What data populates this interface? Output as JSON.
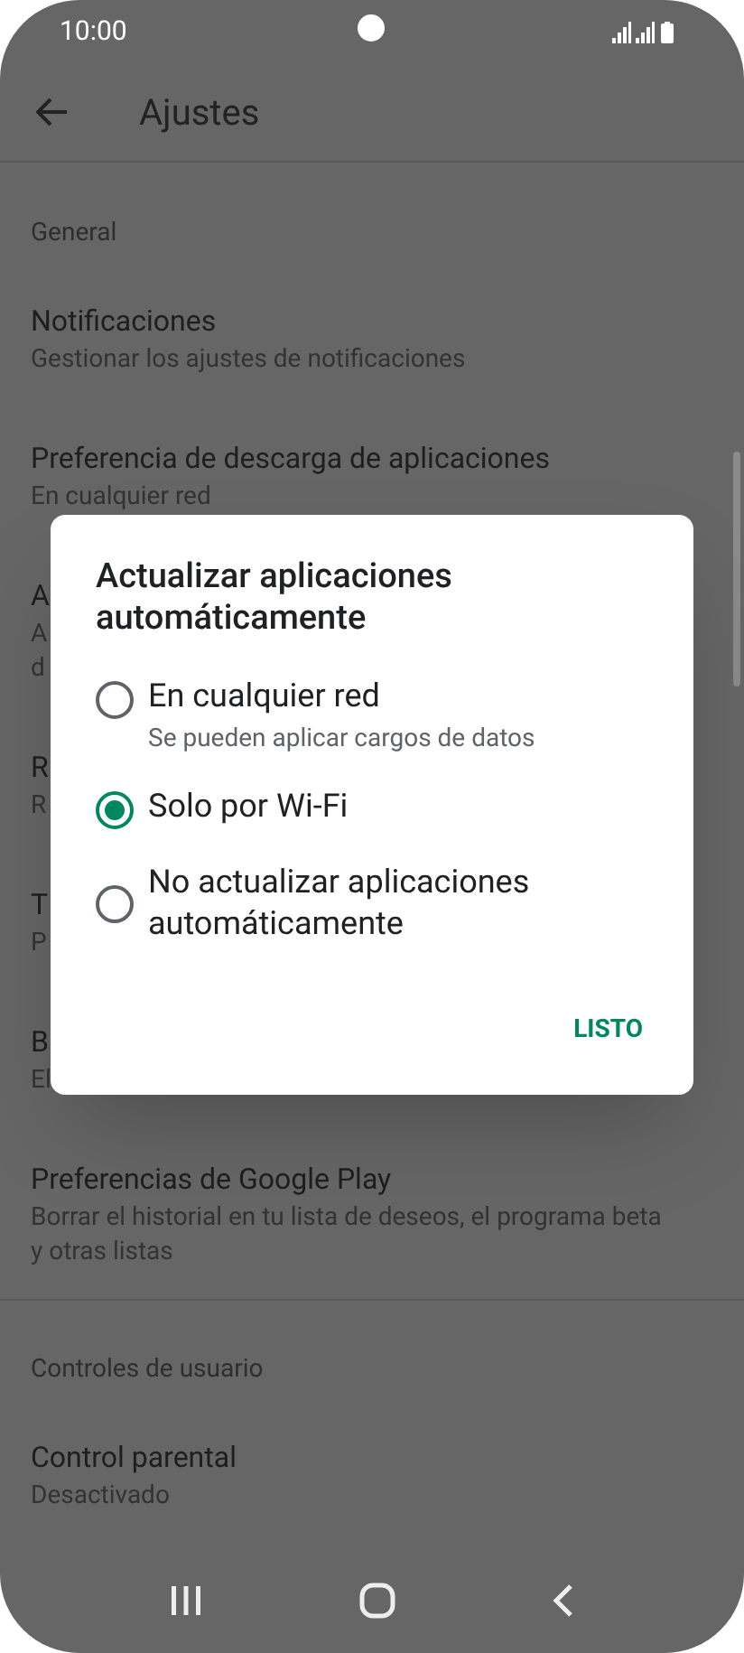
{
  "status_bar": {
    "time": "10:00"
  },
  "header": {
    "title": "Ajustes"
  },
  "sections": [
    {
      "heading": "General",
      "items": [
        {
          "title": "Notificaciones",
          "subtitle": [
            "Gestionar los ajustes de notificaciones"
          ]
        },
        {
          "title": "Preferencia de descarga de aplicaciones",
          "subtitle": [
            "En cualquier red"
          ]
        },
        {
          "title": "A",
          "subtitle": [
            "A",
            "d"
          ]
        },
        {
          "title": "R",
          "subtitle": [
            "R"
          ]
        },
        {
          "title": "T",
          "subtitle": [
            "P"
          ]
        },
        {
          "title": "B",
          "subtitle": [
            "El"
          ]
        },
        {
          "title": "Preferencias de Google Play",
          "subtitle": [
            "Borrar el historial en tu lista de deseos, el programa beta",
            "y otras listas"
          ]
        }
      ]
    },
    {
      "heading": "Controles de usuario",
      "items": [
        {
          "title": "Control parental",
          "subtitle": [
            "Desactivado"
          ]
        }
      ]
    }
  ],
  "dialog": {
    "title": "Actualizar aplicaciones automáticamente",
    "options": [
      {
        "label": "En cualquier red",
        "sublabel": "Se pueden aplicar cargos de datos",
        "selected": false
      },
      {
        "label": "Solo por Wi-Fi",
        "selected": true
      },
      {
        "label": "No actualizar aplicaciones automáticamente",
        "selected": false
      }
    ],
    "button": "LISTO"
  }
}
